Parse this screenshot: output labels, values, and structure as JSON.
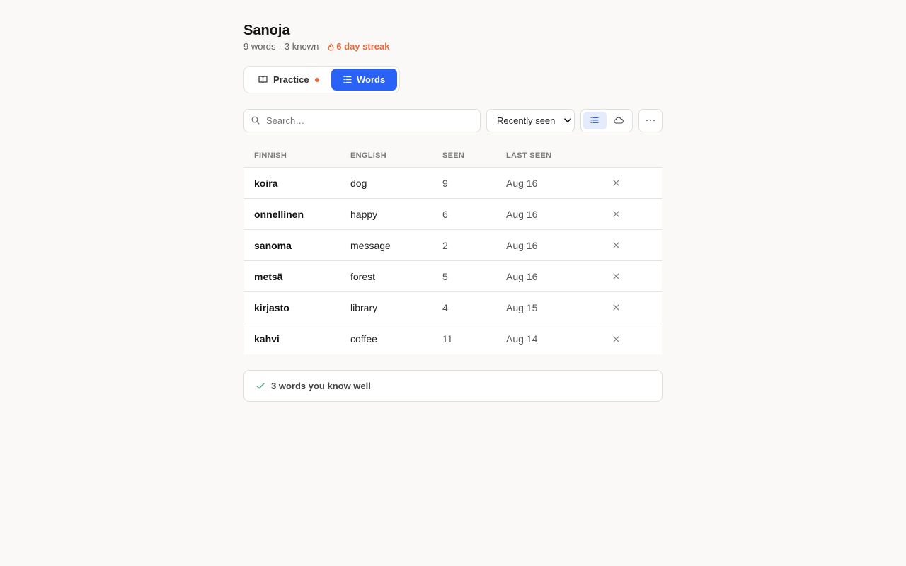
{
  "app": {
    "title": "Sanoja",
    "word_count": "9 words",
    "separator": "·",
    "known_count": "3 known",
    "streak": "6 day streak"
  },
  "tabs": [
    {
      "label": "Practice",
      "icon": "book-icon",
      "has_dot": true
    },
    {
      "label": "Words",
      "icon": "list-icon",
      "active": true
    }
  ],
  "toolbar": {
    "search_placeholder": "Search…",
    "sort_selected": "Recently seen",
    "view_modes": [
      "list-icon",
      "cloud-icon"
    ],
    "more_icon": "more-icon"
  },
  "table": {
    "headers": [
      "FINNISH",
      "ENGLISH",
      "SEEN",
      "LAST SEEN"
    ],
    "rows": [
      {
        "finnish": "koira",
        "english": "dog",
        "seen": "9",
        "last_seen": "Aug 16"
      },
      {
        "finnish": "onnellinen",
        "english": "happy",
        "seen": "6",
        "last_seen": "Aug 16"
      },
      {
        "finnish": "sanoma",
        "english": "message",
        "seen": "2",
        "last_seen": "Aug 16"
      },
      {
        "finnish": "metsä",
        "english": "forest",
        "seen": "5",
        "last_seen": "Aug 16"
      },
      {
        "finnish": "kirjasto",
        "english": "library",
        "seen": "4",
        "last_seen": "Aug 15"
      },
      {
        "finnish": "kahvi",
        "english": "coffee",
        "seen": "11",
        "last_seen": "Aug 14"
      }
    ]
  },
  "known_section": {
    "label": "3 words you know well"
  },
  "colors": {
    "accent": "#2b62f6",
    "streak": "#e2683c",
    "check": "#3aa57a",
    "background": "#faf9f7"
  }
}
